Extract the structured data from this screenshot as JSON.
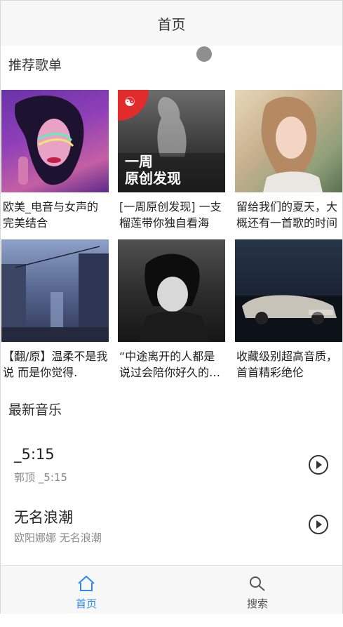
{
  "header": {
    "title": "首页"
  },
  "sections": {
    "recommended": "推荐歌单",
    "latest": "最新音乐"
  },
  "playlists": [
    {
      "caption": "欧美_电音与女声的完美结合",
      "art": "neon-portrait"
    },
    {
      "caption": "[一周原创发现] 一支榴莲带你独自看海",
      "art": "weekly-original",
      "overlay": "一周\n原创发现"
    },
    {
      "caption": "留给我们的夏天，大概还有一首歌的时间",
      "art": "summer-girl"
    },
    {
      "caption": "【翻/原】温柔不是我说 而是你觉得.",
      "art": "dusk-street"
    },
    {
      "caption": "“中途离开的人都是说过会陪你好久的人”",
      "art": "anime-boy"
    },
    {
      "caption": "收藏级别超高音质，首首精彩绝伦",
      "art": "night-car"
    }
  ],
  "songs": [
    {
      "title": "_5:15",
      "artist": "郭顶 _5:15"
    },
    {
      "title": "无名浪潮",
      "artist": "欧阳娜娜 无名浪潮"
    },
    {
      "title": "",
      "artist": ""
    }
  ],
  "tabbar": {
    "home": "首页",
    "search": "搜索"
  },
  "colors": {
    "accent": "#2d89f0",
    "badge": "#e22b2b"
  }
}
